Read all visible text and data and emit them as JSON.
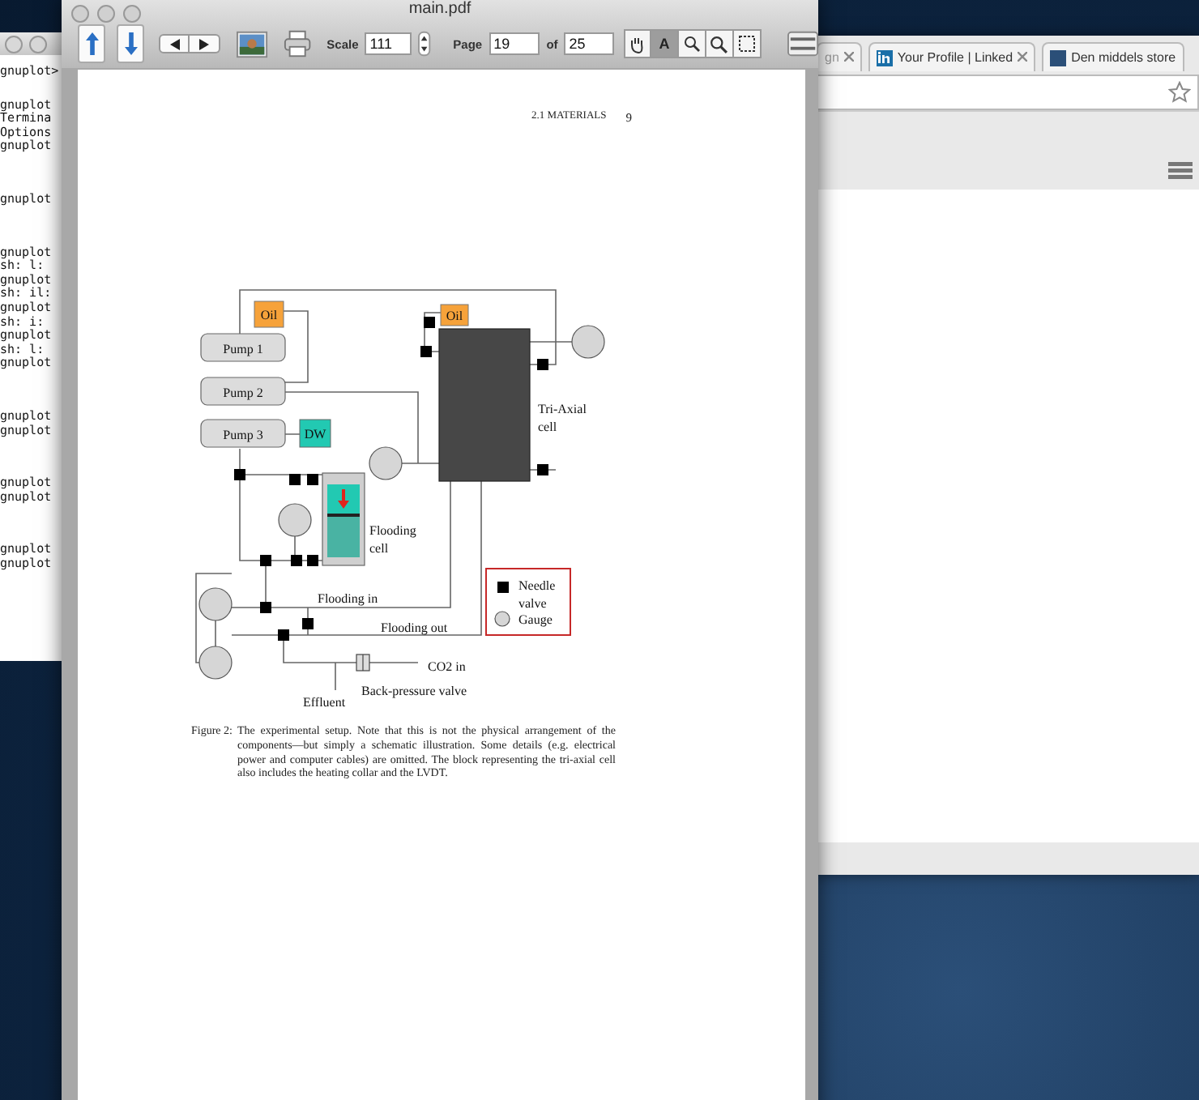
{
  "terminal": {
    "blocks": [
      [
        "gnuplot>"
      ],
      [
        "gnuplot",
        "Termina",
        "Options",
        "gnuplot"
      ],
      [
        "gnuplot"
      ],
      [
        "gnuplot",
        "sh: l:",
        "gnuplot",
        "sh: il:",
        "gnuplot",
        "sh: i:",
        "gnuplot",
        "sh: l:",
        "gnuplot"
      ],
      [
        "gnuplot",
        "gnuplot"
      ],
      [
        "gnuplot",
        "gnuplot"
      ],
      [
        "gnuplot",
        "gnuplot"
      ]
    ]
  },
  "browser": {
    "tabs": [
      {
        "title": "gn",
        "kind": "text"
      },
      {
        "title": "Your Profile | Linked",
        "kind": "linkedin"
      },
      {
        "title": "Den middels store",
        "kind": "site"
      }
    ]
  },
  "viewer": {
    "title": "main.pdf",
    "scale_label": "Scale",
    "scale": "111",
    "page_label": "Page",
    "page": "19",
    "of_label": "of",
    "pages": "25",
    "tools": [
      {
        "kind": "hand",
        "selected": false
      },
      {
        "kind": "text",
        "label": "A",
        "selected": true
      },
      {
        "kind": "zoom",
        "selected": false
      },
      {
        "kind": "zoom",
        "selected": false
      },
      {
        "kind": "select",
        "selected": false
      }
    ]
  },
  "page": {
    "section": "2.1 MATERIALS",
    "number": "9",
    "diagram": {
      "pumps": [
        "Pump 1",
        "Pump 2",
        "Pump 3"
      ],
      "oil_labels": [
        "Oil",
        "Oil"
      ],
      "water_label": "DW",
      "triaxial_label": [
        "Tri-Axial",
        "cell"
      ],
      "flooding_cell_label": [
        "Flooding",
        "cell"
      ],
      "flooding_in": "Flooding in",
      "flooding_out": "Flooding out",
      "co2_in": "CO2 in",
      "back_pressure_valve": "Back-pressure valve",
      "effluent": "Effluent",
      "legend": [
        {
          "kind": "valve",
          "label": [
            "Needle",
            "valve"
          ]
        },
        {
          "kind": "gauge",
          "label": [
            "Gauge"
          ]
        }
      ]
    },
    "caption": {
      "label": "Figure 2:",
      "text": "The experimental setup. Note that this is not the physical arrangement of the components—but simply a schematic illustration. Some details (e.g. electrical power and computer cables) are omitted. The block representing the tri-axial cell also includes the heating collar and the LVDT."
    }
  }
}
